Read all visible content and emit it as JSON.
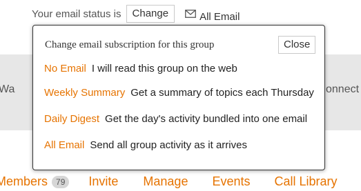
{
  "status": {
    "label": "Your email status is",
    "change_button": "Change",
    "current": "All Email",
    "icon": "mail-icon"
  },
  "background": {
    "left_fragment": "Wa",
    "right_fragment": "onnect"
  },
  "popup": {
    "title": "Change email subscription for this group",
    "close_button": "Close",
    "options": [
      {
        "name": "No Email",
        "description": "I will read this group on the web"
      },
      {
        "name": "Weekly Summary",
        "description": "Get a summary of topics each Thursday"
      },
      {
        "name": "Daily Digest",
        "description": "Get the day's activity bundled into one email"
      },
      {
        "name": "All Email",
        "description": "Send all group activity as it arrives"
      }
    ]
  },
  "nav": {
    "members": "Members",
    "members_count": "79",
    "invite": "Invite",
    "manage": "Manage",
    "events": "Events",
    "call_library": "Call Library"
  },
  "colors": {
    "accent": "#e67300",
    "band": "#e7e7e7",
    "text": "#222222"
  }
}
